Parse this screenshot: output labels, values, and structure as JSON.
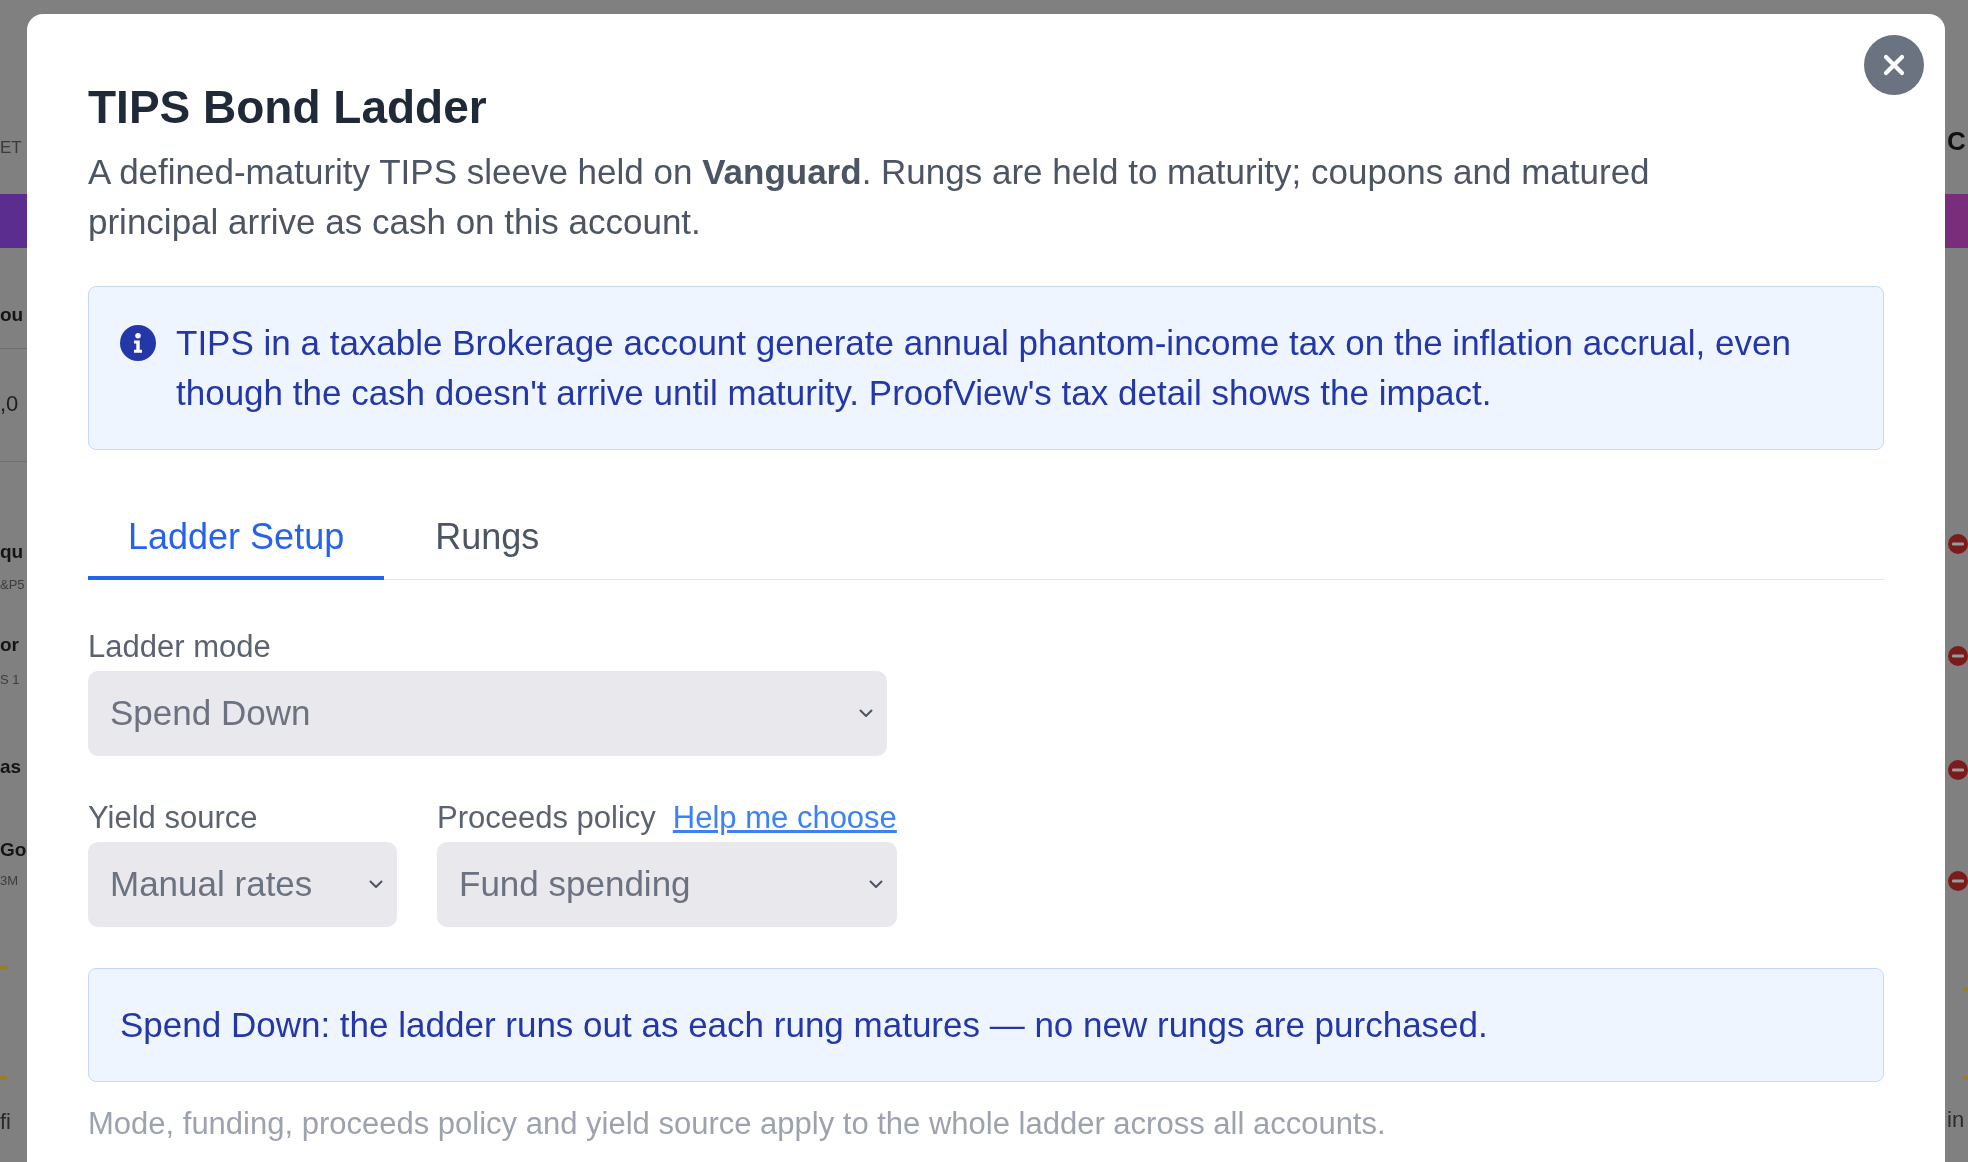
{
  "backdrop": {
    "left_texts": [
      {
        "text": "ET",
        "kind": "caption"
      },
      {
        "text": "ou",
        "kind": "heading"
      },
      {
        "text": ",0",
        "kind": "figure"
      },
      {
        "text": "qu",
        "kind": "heading"
      },
      {
        "text": "&P5",
        "kind": "detail"
      },
      {
        "text": "or",
        "kind": "heading"
      },
      {
        "text": "S 1",
        "kind": "detail"
      },
      {
        "text": "as",
        "kind": "heading"
      },
      {
        "text": "Go",
        "kind": "heading"
      },
      {
        "text": "3M",
        "kind": "detail"
      },
      {
        "text": "fi",
        "kind": "body"
      }
    ],
    "right_texts": [
      {
        "text": "C",
        "kind": "title"
      },
      {
        "text": "in",
        "kind": "body"
      }
    ]
  },
  "dialog": {
    "title": "TIPS Bond Ladder",
    "description": "A defined-maturity TIPS sleeve held on **Vanguard**. Rungs are held to maturity; coupons and matured principal arrive as cash on this account.",
    "notice": "TIPS in a taxable Brokerage account generate annual phantom-income tax on the inflation accrual, even though the cash doesn't arrive until maturity. ProofView's tax detail shows the impact.",
    "tabs": [
      {
        "label": "Ladder Setup",
        "selected": true
      },
      {
        "label": "Rungs",
        "selected": false
      }
    ],
    "field_rows": [
      [
        {
          "label": "Ladder mode",
          "value": "Spend Down"
        }
      ],
      [
        {
          "label": "Yield source",
          "value": "Manual rates"
        },
        {
          "label": "Proceeds policy",
          "value": "Fund spending",
          "help_link": "Help me choose"
        }
      ]
    ],
    "mode_note": "Spend Down: the ladder runs out as each rung matures — no new rungs are purchased.",
    "footnote": "Mode, funding, proceeds policy and yield source apply to the whole ladder across all accounts."
  }
}
